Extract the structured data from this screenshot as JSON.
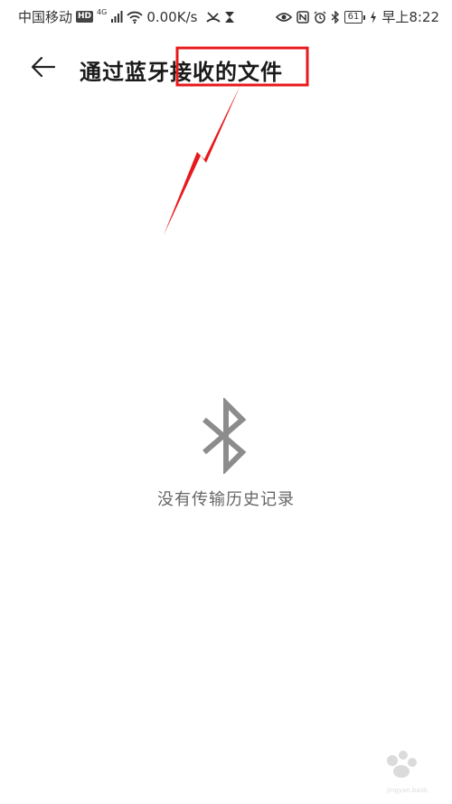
{
  "status_bar": {
    "carrier": "中国移动",
    "hd": "HD",
    "network": "4G",
    "speed": "0.00K/s",
    "battery": "61",
    "time": "早上8:22"
  },
  "header": {
    "title": "通过蓝牙接收的文件"
  },
  "empty_state": {
    "icon": "bluetooth-icon",
    "message": "没有传输历史记录"
  },
  "annotation_color": "#e8191c",
  "watermark": {
    "site": "jingyan.baidu.com"
  }
}
